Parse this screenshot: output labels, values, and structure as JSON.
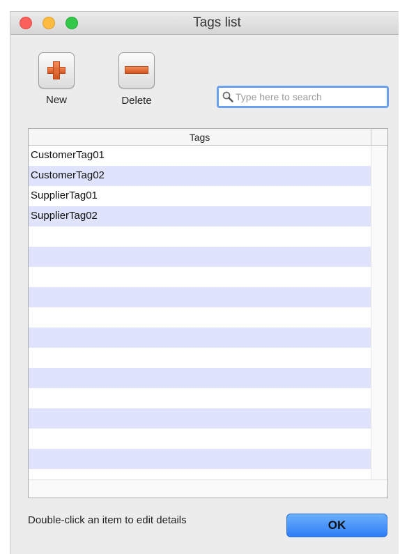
{
  "window": {
    "title": "Tags list"
  },
  "toolbar": {
    "new_label": "New",
    "delete_label": "Delete",
    "new_icon": "plus-icon",
    "delete_icon": "minus-icon"
  },
  "search": {
    "value": "",
    "placeholder": "Type here to search",
    "icon": "search-icon"
  },
  "table": {
    "column_header": "Tags",
    "rows": [
      "CustomerTag01",
      "CustomerTag02",
      "SupplierTag01",
      "SupplierTag02",
      "",
      "",
      "",
      "",
      "",
      "",
      "",
      "",
      "",
      "",
      "",
      ""
    ]
  },
  "footer": {
    "hint": "Double-click an item to edit details",
    "ok_label": "OK"
  },
  "colors": {
    "accent": "#2e7cf6",
    "row_alt": "#dfe3fc",
    "close": "#fc605b",
    "minimize": "#fdbc40",
    "maximize": "#34c84a",
    "tool_icon": "#e06c35"
  }
}
